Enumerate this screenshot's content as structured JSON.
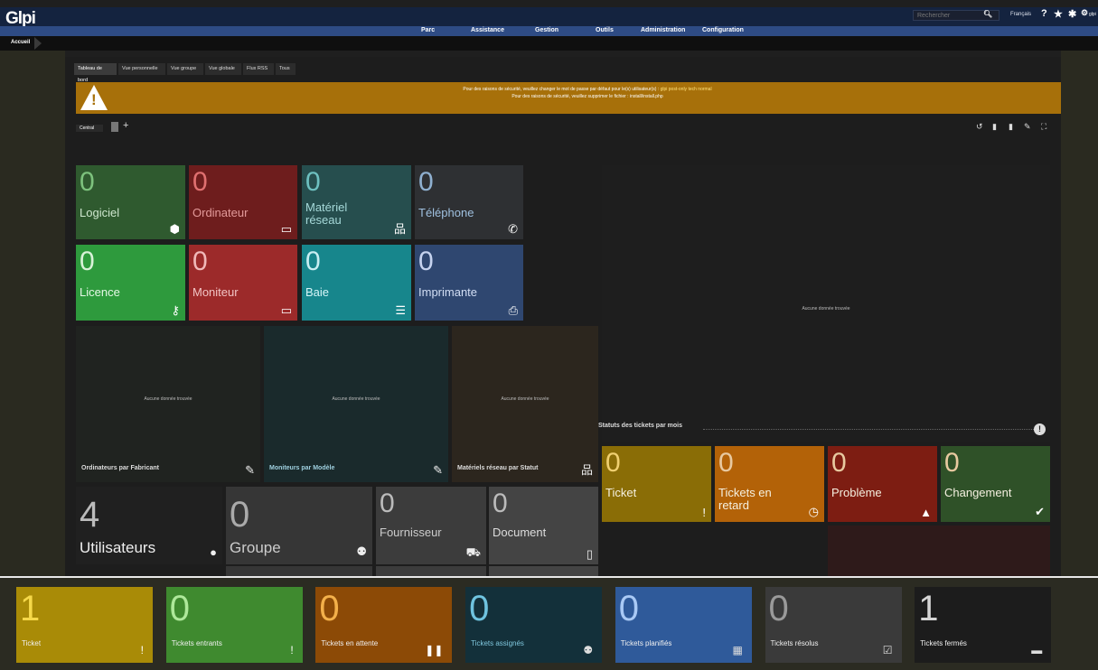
{
  "header": {
    "logo": "Glpi",
    "search_placeholder": "Rechercher",
    "language": "Français",
    "user_initials": "glpi"
  },
  "menu": [
    "Parc",
    "Assistance",
    "Gestion",
    "Outils",
    "Administration",
    "Configuration"
  ],
  "breadcrumb": "Accueil",
  "tabs": [
    "Tableau de bord",
    "Vue personnelle",
    "Vue groupe",
    "Vue globale",
    "Flux RSS",
    "Tous"
  ],
  "warning": {
    "line1": "Pour des raisons de sécurité, veuillez changer le mot de passe par défaut pour le(s) utilisateur(s) :",
    "line1_link": "glpi post-only tech normal",
    "line2": "Pour des raisons de sécurité, veuillez supprimer le fichier : install/install.php"
  },
  "dashboard_select": "Central",
  "tiles": [
    {
      "value": "0",
      "label": "Logiciel",
      "icon": "box-icon",
      "color": "#2f5a2f"
    },
    {
      "value": "0",
      "label": "Ordinateur",
      "icon": "laptop-icon",
      "color": "#6e1d1d"
    },
    {
      "value": "0",
      "label": "Matériel réseau",
      "icon": "network-icon",
      "color": "#264e4e"
    },
    {
      "value": "0",
      "label": "Téléphone",
      "icon": "phone-icon",
      "color": "#2e3033"
    },
    {
      "value": "0",
      "label": "Licence",
      "icon": "key-icon",
      "color": "#2e9a3d"
    },
    {
      "value": "0",
      "label": "Moniteur",
      "icon": "monitor-icon",
      "color": "#9c2a2a"
    },
    {
      "value": "0",
      "label": "Baie",
      "icon": "rack-icon",
      "color": "#17868c"
    },
    {
      "value": "0",
      "label": "Imprimante",
      "icon": "printer-icon",
      "color": "#2f4770"
    }
  ],
  "charts": [
    {
      "title": "Ordinateurs par Fabricant",
      "nodata": "Aucune donnée trouvée",
      "icon": "edit-icon"
    },
    {
      "title": "Moniteurs par Modèle",
      "nodata": "Aucune donnée trouvée",
      "icon": "edit-icon"
    },
    {
      "title": "Matériels réseau par Statut",
      "nodata": "Aucune donnée trouvée",
      "icon": "sitemap-icon"
    }
  ],
  "right_chart": {
    "nodata": "Aucune donnée trouvée",
    "title": "Statuts des tickets par mois"
  },
  "counters": [
    {
      "value": "4",
      "label": "Utilisateurs",
      "icon": "user-icon"
    },
    {
      "value": "0",
      "label": "Groupe",
      "icon": "users-icon"
    },
    {
      "value": "0",
      "label": "Fournisseur",
      "icon": "dolly-icon"
    },
    {
      "value": "0",
      "label": "Document",
      "icon": "file-icon"
    }
  ],
  "itil": [
    {
      "value": "0",
      "label": "Ticket",
      "icon": "exclamation-icon",
      "color": "#8a6d06"
    },
    {
      "value": "0",
      "label": "Tickets en retard",
      "icon": "clock-icon",
      "color": "#b36208"
    },
    {
      "value": "0",
      "label": "Problème",
      "icon": "warning-icon",
      "color": "#7d1d12"
    },
    {
      "value": "0",
      "label": "Changement",
      "icon": "clipboard-icon",
      "color": "#2f5128"
    }
  ],
  "bottom_tiles": [
    {
      "value": "1",
      "label": "Ticket",
      "icon": "exclamation-icon",
      "color": "#a98b07"
    },
    {
      "value": "0",
      "label": "Tickets entrants",
      "icon": "exclamation-icon",
      "color": "#3f8a2f"
    },
    {
      "value": "0",
      "label": "Tickets en attente",
      "icon": "pause-icon",
      "color": "#8c4a06"
    },
    {
      "value": "0",
      "label": "Tickets assignés",
      "icon": "users-icon",
      "color": "#13303a"
    },
    {
      "value": "0",
      "label": "Tickets planifiés",
      "icon": "calendar-icon",
      "color": "#2f5a9a"
    },
    {
      "value": "0",
      "label": "Tickets résolus",
      "icon": "check-icon",
      "color": "#3a3a3a"
    },
    {
      "value": "1",
      "label": "Tickets fermés",
      "icon": "archive-icon",
      "color": "#1c1c1c"
    }
  ]
}
